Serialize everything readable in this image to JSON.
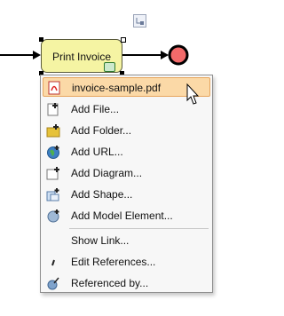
{
  "diagram": {
    "task_label": "Print Invoice"
  },
  "context_menu": {
    "items": [
      {
        "label": "invoice-sample.pdf",
        "icon": "pdf-icon"
      },
      {
        "label": "Add File...",
        "icon": "add-file-icon"
      },
      {
        "label": "Add Folder...",
        "icon": "add-folder-icon"
      },
      {
        "label": "Add URL...",
        "icon": "add-url-icon"
      },
      {
        "label": "Add Diagram...",
        "icon": "add-diagram-icon"
      },
      {
        "label": "Add Shape...",
        "icon": "add-shape-icon"
      },
      {
        "label": "Add Model Element...",
        "icon": "add-model-element-icon"
      },
      {
        "label": "Show Link...",
        "icon": ""
      },
      {
        "label": "Edit References...",
        "icon": "edit-references-icon"
      },
      {
        "label": "Referenced by...",
        "icon": "referenced-by-icon"
      }
    ],
    "highlighted_index": 0
  },
  "colors": {
    "task_fill": "#f5f4a3",
    "end_event_fill": "#f26a6a",
    "menu_highlight": "#fbd9a7"
  }
}
